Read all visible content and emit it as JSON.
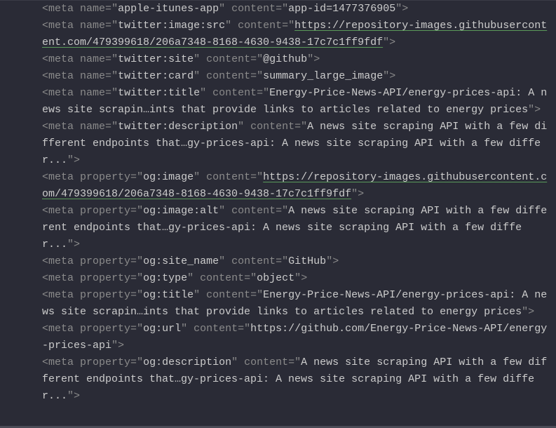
{
  "lines": [
    {
      "type": "meta-name",
      "attr": "name",
      "key": "apple-itunes-app",
      "content": "app-id=1477376905",
      "isLink": false
    },
    {
      "type": "meta-name",
      "attr": "name",
      "key": "twitter:image:src",
      "content": "https://repository-images.githubusercontent.com/479399618/206a7348-8168-4630-9438-17c7c1ff9fdf",
      "isLink": true
    },
    {
      "type": "meta-name",
      "attr": "name",
      "key": "twitter:site",
      "content": "@github",
      "isLink": false
    },
    {
      "type": "meta-name",
      "attr": "name",
      "key": "twitter:card",
      "content": "summary_large_image",
      "isLink": false
    },
    {
      "type": "meta-name",
      "attr": "name",
      "key": "twitter:title",
      "content": "Energy-Price-News-API/energy-prices-api: A news site scrapin…ints that provide links to articles related to energy prices",
      "isLink": false
    },
    {
      "type": "meta-name",
      "attr": "name",
      "key": "twitter:description",
      "content": "A news site scraping API with a few different endpoints that…gy-prices-api: A news site scraping API with a few differ...",
      "isLink": false
    },
    {
      "type": "meta-property",
      "attr": "property",
      "key": "og:image",
      "content": "https://repository-images.githubusercontent.com/479399618/206a7348-8168-4630-9438-17c7c1ff9fdf",
      "isLink": true
    },
    {
      "type": "meta-property",
      "attr": "property",
      "key": "og:image:alt",
      "content": "A news site scraping API with a few different endpoints that…gy-prices-api: A news site scraping API with a few differ...",
      "isLink": false
    },
    {
      "type": "meta-property",
      "attr": "property",
      "key": "og:site_name",
      "content": "GitHub",
      "isLink": false
    },
    {
      "type": "meta-property",
      "attr": "property",
      "key": "og:type",
      "content": "object",
      "isLink": false
    },
    {
      "type": "meta-property",
      "attr": "property",
      "key": "og:title",
      "content": "Energy-Price-News-API/energy-prices-api: A news site scrapin…ints that provide links to articles related to energy prices",
      "isLink": false
    },
    {
      "type": "meta-property",
      "attr": "property",
      "key": "og:url",
      "content": "https://github.com/Energy-Price-News-API/energy-prices-api",
      "isLink": false
    },
    {
      "type": "meta-property",
      "attr": "property",
      "key": "og:description",
      "content": "A news site scraping API with a few different endpoints that…gy-prices-api: A news site scraping API with a few differ...",
      "isLink": false
    }
  ]
}
